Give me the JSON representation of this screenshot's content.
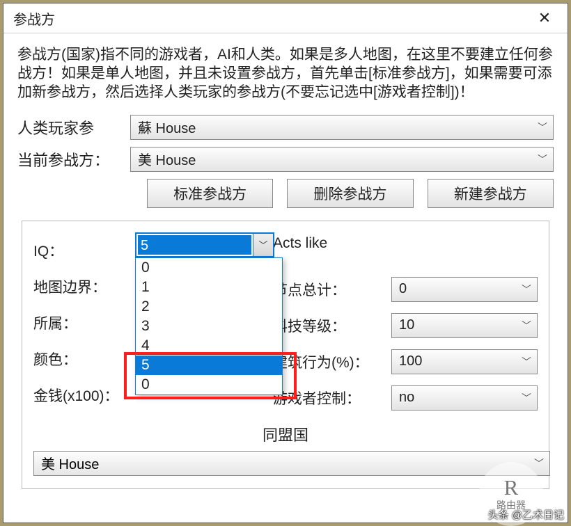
{
  "title": "参战方",
  "description": "参战方(国家)指不同的游戏者，AI和人类。如果是多人地图，在这里不要建立任何参战方！如果是单人地图，并且未设置参战方，首先单击[标准参战方]，如果需要可添加新参战方，然后选择人类玩家的参战方(不要忘记选中[游戏者控制])！",
  "labels": {
    "human_player": "人类玩家参",
    "current_side": "当前参战方：",
    "iq": "IQ：",
    "map_border": "地图边界：",
    "owner": "所属：",
    "color": "颜色：",
    "money": "金钱(x100)：",
    "acts_like": "Acts like",
    "node_total": "节点总计：",
    "tech_level": "科技等级：",
    "build_pct": "建筑行为(%)：",
    "player_control": "游戏者控制：",
    "ally": "同盟国"
  },
  "selects": {
    "human_player": "蘇 House",
    "current_side": "美 House",
    "node_total": "0",
    "tech_level": "10",
    "build_pct": "100",
    "player_control": "no",
    "ally": "美 House"
  },
  "buttons": {
    "standard": "标准参战方",
    "delete": "删除参战方",
    "new": "新建参战方"
  },
  "iq": {
    "value": "5",
    "options": [
      "0",
      "1",
      "2",
      "3",
      "4",
      "5",
      "0"
    ],
    "selected_index": 5
  },
  "watermark": "头条 @乙术日记",
  "badge_top": "R",
  "badge_bottom": "路由器"
}
